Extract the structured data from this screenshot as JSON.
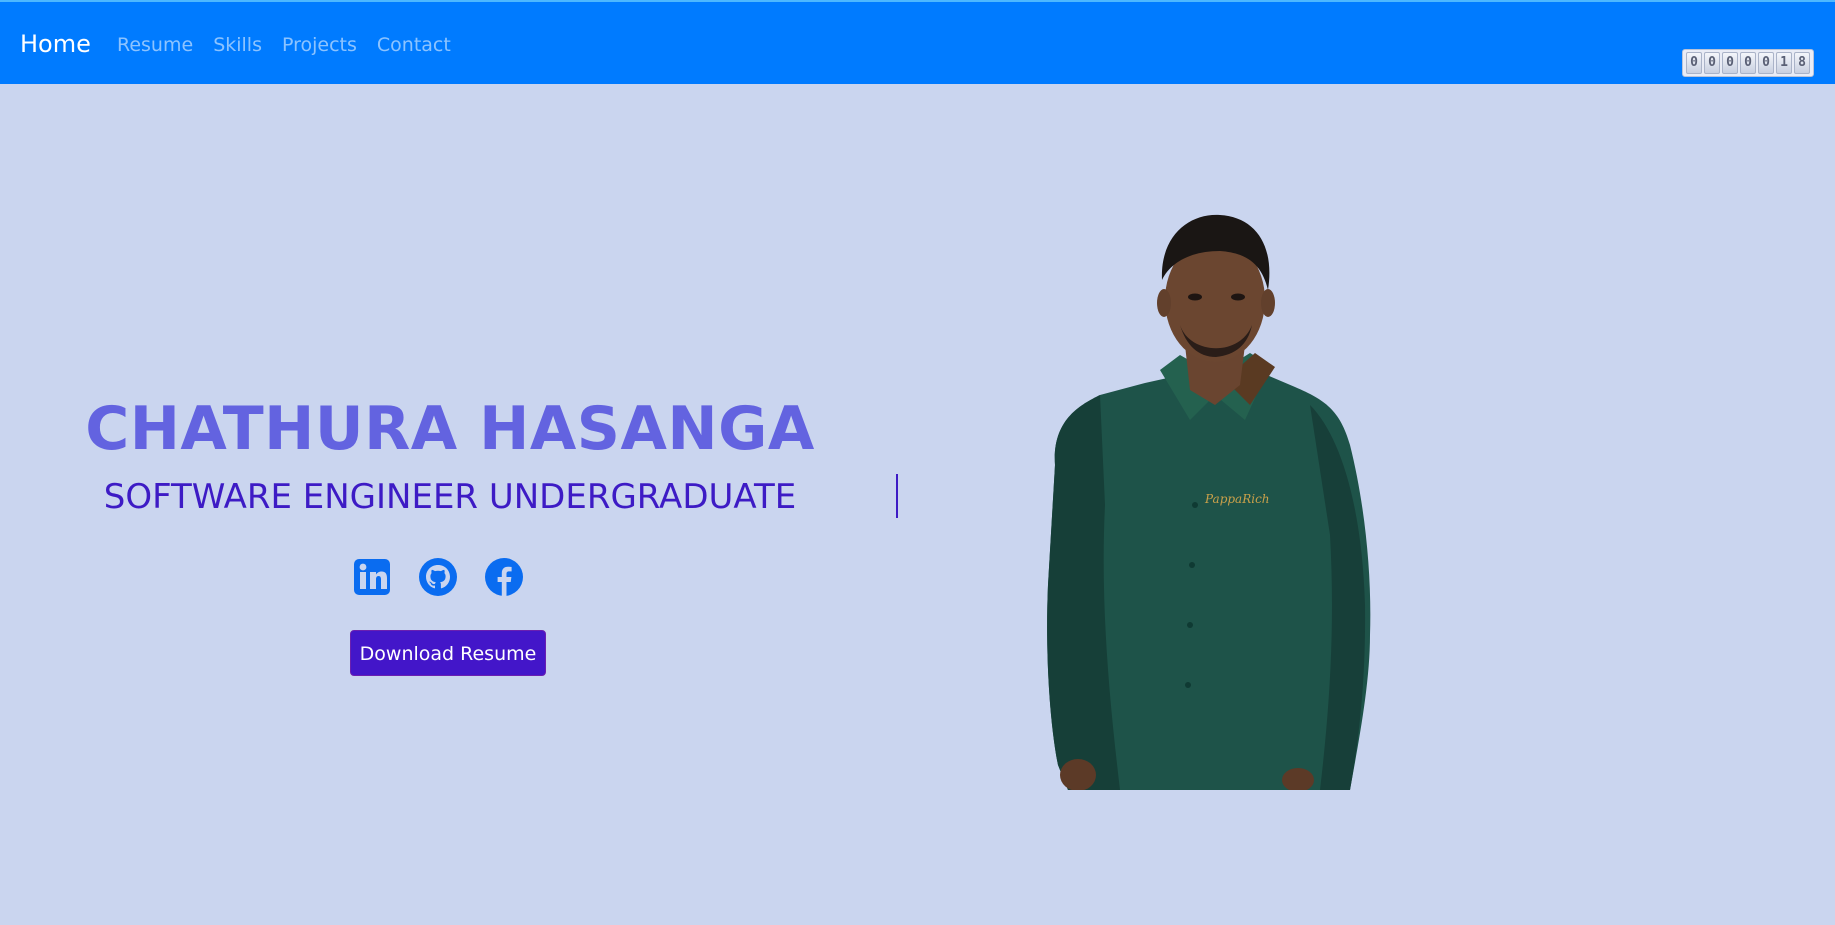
{
  "navbar": {
    "brand": "Home",
    "links": [
      "Resume",
      "Skills",
      "Projects",
      "Contact"
    ],
    "visitor_counter": [
      "0",
      "0",
      "0",
      "0",
      "0",
      "1",
      "8"
    ]
  },
  "hero": {
    "name": "CHATHURA HASANGA",
    "title": "SOFTWARE ENGINEER UNDERGRADUATE",
    "download_label": "Download Resume",
    "photo_caption_logo": "PappaRich"
  },
  "socials": [
    {
      "icon": "linkedin-icon"
    },
    {
      "icon": "github-icon"
    },
    {
      "icon": "facebook-icon"
    }
  ],
  "colors": {
    "navbar": "#007bff",
    "background": "#cad5ef",
    "name": "#6363e0",
    "title": "#3d1bc5",
    "button": "#4316c9",
    "social_icons": "#0a6cf0"
  }
}
